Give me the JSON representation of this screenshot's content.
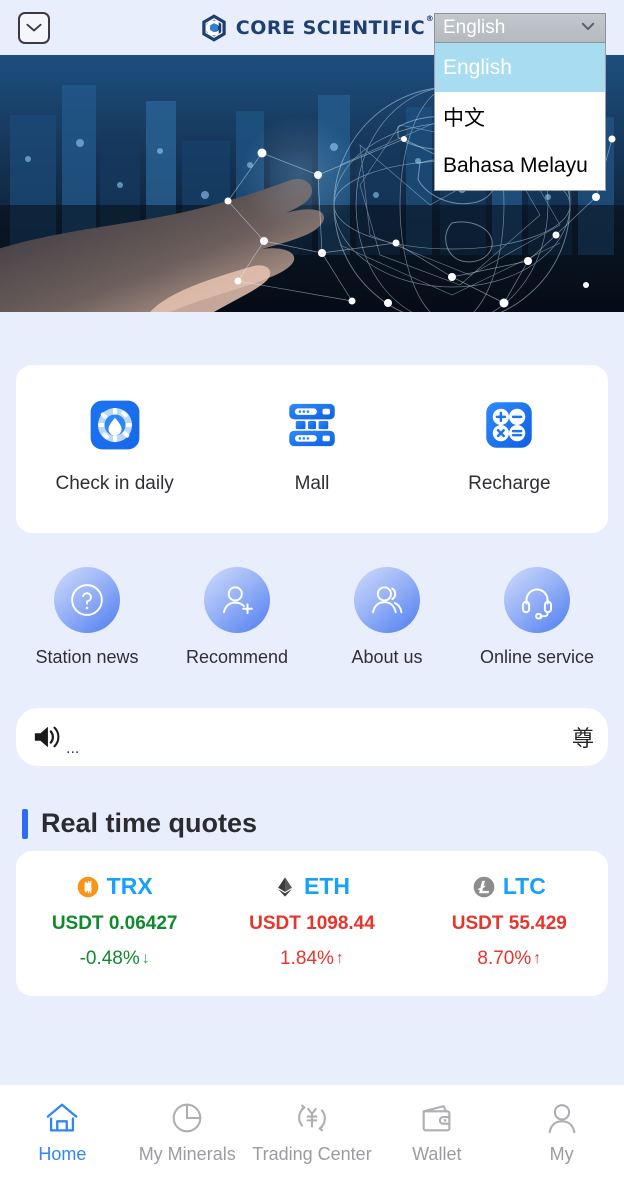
{
  "header": {
    "mail_icon": "envelope-icon",
    "brand": "CORE SCIENTIFIC",
    "brand_sup": "®"
  },
  "language": {
    "selected": "English",
    "caret": "⌄",
    "options": [
      "English",
      "中文",
      "Bahasa Melayu"
    ],
    "highlighted_index": 0
  },
  "banner": {
    "alt": "hand touching digital globe network over city skyline"
  },
  "shortcuts": [
    {
      "label": "Check in daily",
      "icon": "check-in-wheel-icon"
    },
    {
      "label": "Mall",
      "icon": "server-stack-icon"
    },
    {
      "label": "Recharge",
      "icon": "calculator-icon"
    }
  ],
  "round_items": [
    {
      "label": "Station news",
      "icon": "question-mark-icon"
    },
    {
      "label": "Recommend",
      "icon": "user-add-icon"
    },
    {
      "label": "About us",
      "icon": "users-icon"
    },
    {
      "label": "Online service",
      "icon": "headset-icon"
    }
  ],
  "notice": {
    "icon": "speaker-icon",
    "text": "...",
    "tail_text": "尊"
  },
  "quotes": {
    "title": "Real time quotes",
    "accent_color": "#2f6bf2",
    "up_color": "#e8352c",
    "down_color": "#0f9c3a",
    "items": [
      {
        "symbol": "TRX",
        "coin_icon": "bitcoin-coin-icon",
        "price": "USDT 0.06427",
        "change": "-0.48%",
        "arrow": "↓",
        "direction": "down",
        "color": "#0f8a2e"
      },
      {
        "symbol": "ETH",
        "coin_icon": "ethereum-icon",
        "price": "USDT 1098.44",
        "change": "1.84%",
        "arrow": "↑",
        "direction": "up",
        "color": "#e8352c"
      },
      {
        "symbol": "LTC",
        "coin_icon": "litecoin-icon",
        "price": "USDT 55.429",
        "change": "8.70%",
        "arrow": "↑",
        "direction": "up",
        "color": "#e8352c"
      }
    ]
  },
  "bottom_nav": {
    "active_color": "#2f86f6",
    "inactive_color": "#9b9ba1",
    "items": [
      {
        "label": "Home",
        "icon": "home-icon",
        "active": true
      },
      {
        "label": "My Minerals",
        "icon": "pie-chart-icon",
        "active": false
      },
      {
        "label": "Trading\nCenter",
        "icon": "yen-exchange-icon",
        "active": false
      },
      {
        "label": "Wallet",
        "icon": "wallet-icon",
        "active": false
      },
      {
        "label": "My",
        "icon": "person-icon",
        "active": false
      }
    ]
  }
}
